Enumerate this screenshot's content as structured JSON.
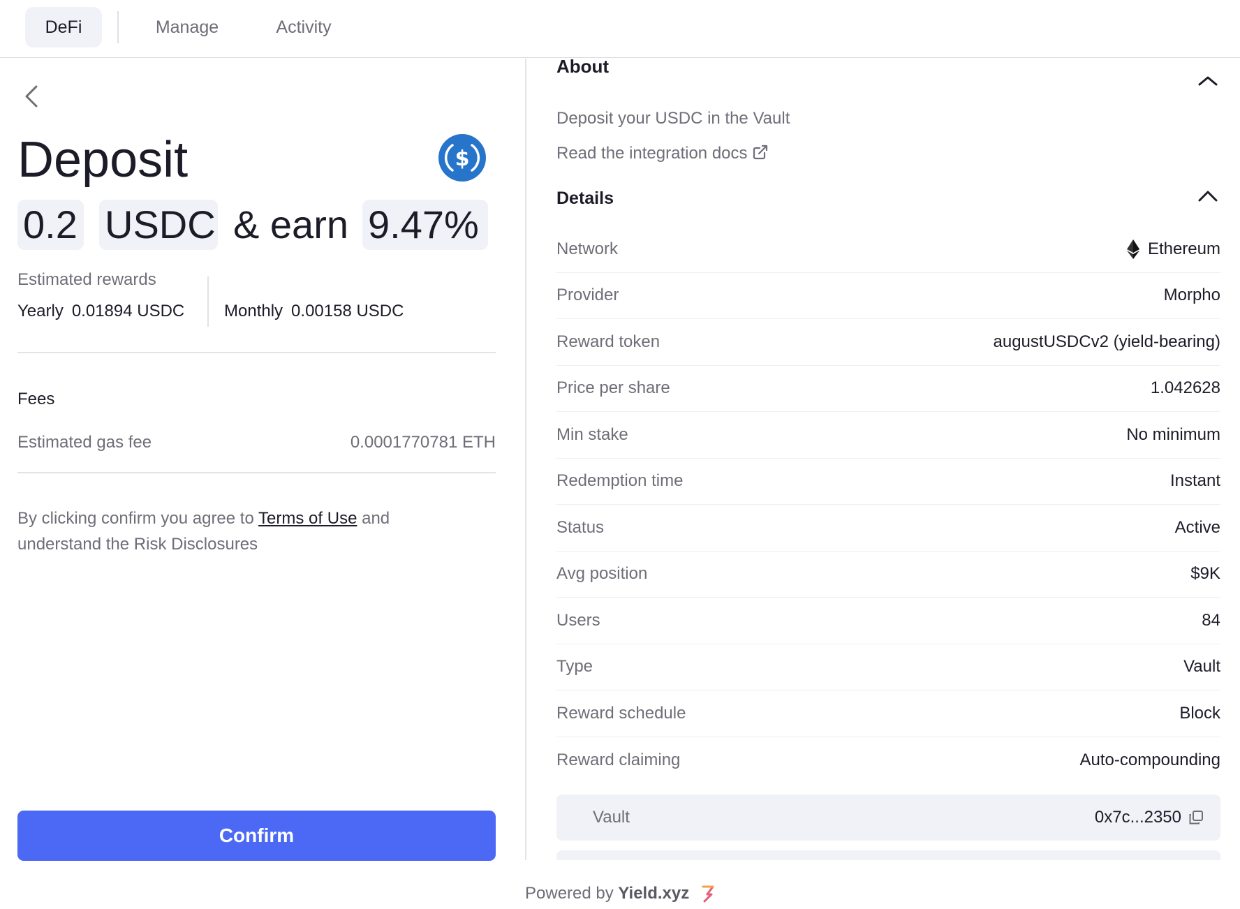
{
  "nav": {
    "tabs": [
      {
        "label": "DeFi",
        "active": true
      },
      {
        "label": "Manage",
        "active": false
      },
      {
        "label": "Activity",
        "active": false
      }
    ]
  },
  "deposit": {
    "title": "Deposit",
    "amount": "0.2",
    "token": "USDC",
    "earn_text": "& earn",
    "apy": "9.47%",
    "token_icon": "usdc-logo-icon",
    "estimated_rewards_label": "Estimated rewards",
    "yearly_label": "Yearly",
    "yearly_value": "0.01894 USDC",
    "monthly_label": "Monthly",
    "monthly_value": "0.00158 USDC"
  },
  "fees": {
    "heading": "Fees",
    "gas_label": "Estimated gas fee",
    "gas_value": "0.0001770781 ETH"
  },
  "terms": {
    "prefix": "By clicking confirm you agree to",
    "link": "Terms of Use",
    "suffix": "and understand the Risk Disclosures"
  },
  "confirm_label": "Confirm",
  "about": {
    "title": "About",
    "description": "Deposit your USDC in the Vault",
    "docs_link": "Read the integration docs"
  },
  "details": {
    "title": "Details",
    "rows": [
      {
        "label": "Network",
        "value": "Ethereum"
      },
      {
        "label": "Provider",
        "value": "Morpho"
      },
      {
        "label": "Reward token",
        "value": "augustUSDCv2 (yield-bearing)"
      },
      {
        "label": "Price per share",
        "value": "1.042628"
      },
      {
        "label": "Min stake",
        "value": "No minimum"
      },
      {
        "label": "Redemption time",
        "value": "Instant"
      },
      {
        "label": "Status",
        "value": "Active"
      },
      {
        "label": "Avg position",
        "value": "$9K"
      },
      {
        "label": "Users",
        "value": "84"
      },
      {
        "label": "Type",
        "value": "Vault"
      },
      {
        "label": "Reward schedule",
        "value": "Block"
      },
      {
        "label": "Reward claiming",
        "value": "Auto-compounding"
      }
    ],
    "vault_label": "Vault",
    "vault_address": "0x7c...2350"
  },
  "footer": {
    "prefix": "Powered by",
    "brand": "Yield.xyz"
  },
  "colors": {
    "accent": "#4c69f6",
    "usdc": "#2775ca",
    "chip_bg": "#f1f2f8",
    "muted_text": "#6e6e78"
  }
}
